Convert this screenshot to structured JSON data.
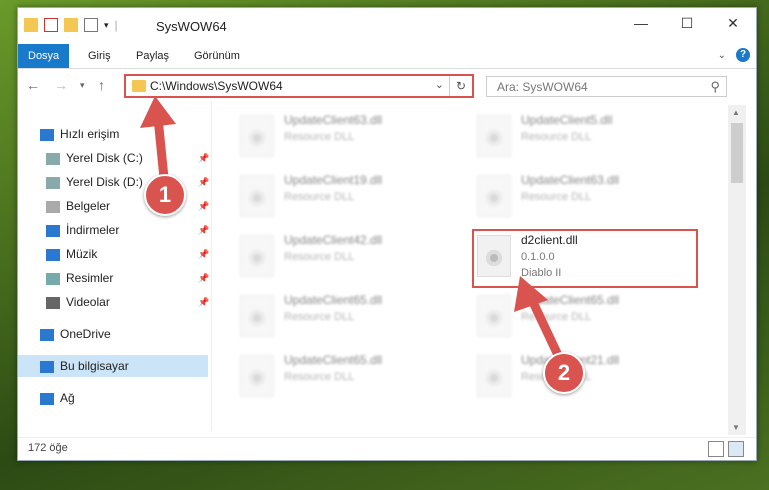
{
  "window": {
    "title": "SysWOW64",
    "controls": {
      "minimize": "—",
      "maximize": "☐",
      "close": "✕"
    }
  },
  "ribbon": {
    "tabs": [
      {
        "label": "Dosya",
        "active": true
      },
      {
        "label": "Giriş",
        "active": false
      },
      {
        "label": "Paylaş",
        "active": false
      },
      {
        "label": "Görünüm",
        "active": false
      }
    ],
    "help": "?"
  },
  "address": {
    "path": "C:\\Windows\\SysWOW64",
    "search_placeholder": "Ara: SysWOW64"
  },
  "sidebar": {
    "items": [
      {
        "label": "Hızlı erişim",
        "icon": "star-icon",
        "pinned": false
      },
      {
        "label": "Yerel Disk (C:)",
        "icon": "drive-icon",
        "pinned": true
      },
      {
        "label": "Yerel Disk (D:)",
        "icon": "drive-icon",
        "pinned": true
      },
      {
        "label": "Belgeler",
        "icon": "documents-icon",
        "pinned": true
      },
      {
        "label": "İndirmeler",
        "icon": "download-icon",
        "pinned": true
      },
      {
        "label": "Müzik",
        "icon": "music-icon",
        "pinned": true
      },
      {
        "label": "Resimler",
        "icon": "pictures-icon",
        "pinned": true
      },
      {
        "label": "Videolar",
        "icon": "video-icon",
        "pinned": true
      },
      {
        "label": "OneDrive",
        "icon": "cloud-icon",
        "pinned": false
      },
      {
        "label": "Bu bilgisayar",
        "icon": "computer-icon",
        "pinned": false,
        "selected": true
      },
      {
        "label": "Ağ",
        "icon": "network-icon",
        "pinned": false
      }
    ]
  },
  "files": [
    {
      "name": "UpdateClient63.dll",
      "desc": "Resource DLL",
      "blurred": true
    },
    {
      "name": "UpdateClient5.dll",
      "desc": "Resource DLL",
      "blurred": true
    },
    {
      "name": "UpdateClient19.dll",
      "desc": "Resource DLL",
      "blurred": true
    },
    {
      "name": "UpdateClient63.dll",
      "desc": "Resource DLL",
      "blurred": true
    },
    {
      "name": "UpdateClient42.dll",
      "desc": "Resource DLL",
      "blurred": true
    },
    {
      "name": "d2client.dll",
      "desc": "0.1.0.0",
      "desc2": "Diablo II",
      "blurred": false
    },
    {
      "name": "UpdateClient65.dll",
      "desc": "Resource DLL",
      "blurred": true
    },
    {
      "name": "UpdateClient65.dll",
      "desc": "Resource DLL",
      "blurred": true
    },
    {
      "name": "UpdateClient65.dll",
      "desc": "Resource DLL",
      "blurred": true
    },
    {
      "name": "UpdateClient21.dll",
      "desc": "Resource DLL",
      "blurred": true
    }
  ],
  "status": {
    "count": "172 öğe"
  },
  "annotations": {
    "step1": "1",
    "step2": "2",
    "color": "#d9534f"
  }
}
